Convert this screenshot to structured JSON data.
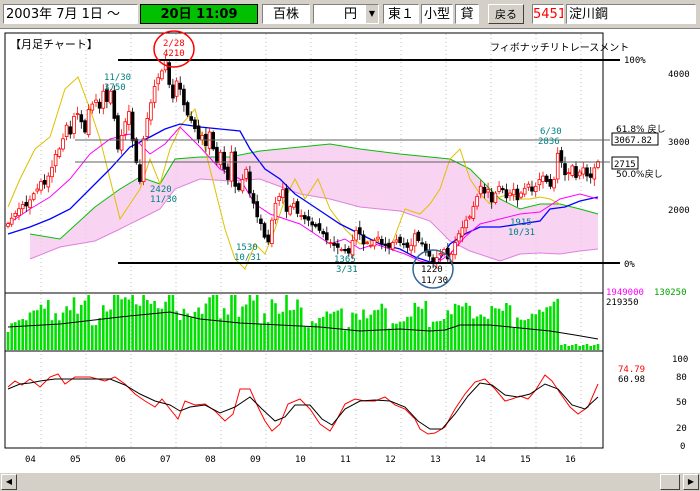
{
  "toolbar": {
    "start_date": "2003年 7月 1日 ～",
    "current_time": "20日 11:09",
    "unit": "百株",
    "currency": "円",
    "market": "東１",
    "size_class": "小型",
    "margin": "貸",
    "back_label": "戻る",
    "stock_code": "5451",
    "stock_name": "淀川鋼"
  },
  "colors": {
    "time_bg": "#00c000",
    "code_color": "#ff0000",
    "up_candle": "#ff0000",
    "down_candle": "#000000",
    "volume": "#00e000",
    "ma_blue": "#0000ff",
    "ma_pink": "#ff00ff",
    "lagging_yellow": "#e0c000",
    "cloud_green": "#00c000",
    "stoch_red": "#ff0000",
    "stoch_black": "#000000",
    "cyan_label": "#008080",
    "marker_red": "#ff0000",
    "marker_blue": "#336699"
  },
  "chart": {
    "title": "【月足チャート】",
    "fib_label": "フィボナッチリトレースメント",
    "fib_levels": [
      "100%",
      "61.8% 戻し",
      "50.0%戻し",
      "0%"
    ],
    "fib_value_618": "3067.82",
    "price_2715": "2715",
    "y_ticks": [
      "4000",
      "3000",
      "2000"
    ],
    "annotations": [
      {
        "date": "11/30",
        "price": "3750"
      },
      {
        "date": "11/30",
        "price": "2420"
      },
      {
        "date": "10/31",
        "price": "1530"
      },
      {
        "date": "3/31",
        "price": "1365"
      },
      {
        "date": "10/31",
        "price": "1915"
      },
      {
        "date": "6/30",
        "price": "2836"
      }
    ],
    "high_marker": {
      "date": "2/28",
      "price": "4210"
    },
    "low_marker": {
      "price": "1220",
      "date": "11/30"
    }
  },
  "volume": {
    "values_left": [
      "1949000",
      "219350"
    ],
    "value_right": "130250"
  },
  "stochastic": {
    "k_value": "74.79",
    "d_value": "60.98",
    "y_ticks": [
      "100",
      "80",
      "50",
      "20",
      "0"
    ]
  },
  "x_axis": [
    "04",
    "05",
    "06",
    "07",
    "08",
    "09",
    "10",
    "11",
    "12",
    "13",
    "14",
    "15",
    "16"
  ],
  "chart_data": {
    "type": "candlestick",
    "title": "【月足チャート】",
    "ylim": [
      1100,
      4400
    ],
    "x": [
      "03/07",
      "03/08",
      "03/09",
      "03/10",
      "03/11",
      "03/12",
      "04/01",
      "04/02",
      "04/03",
      "04/04",
      "04/05",
      "04/06",
      "04/07",
      "04/08",
      "04/09",
      "04/10",
      "04/11",
      "04/12",
      "05/01",
      "05/02",
      "05/03",
      "05/04",
      "05/05",
      "05/06",
      "05/07",
      "05/08",
      "05/09",
      "05/10",
      "05/11",
      "05/12",
      "06/01",
      "06/02",
      "06/03",
      "06/04",
      "06/05",
      "06/06",
      "06/07",
      "06/08",
      "06/09",
      "06/10",
      "06/11",
      "06/12",
      "07/01",
      "07/02",
      "07/03",
      "07/04",
      "07/05",
      "07/06",
      "07/07",
      "07/08",
      "07/09",
      "07/10",
      "07/11",
      "07/12",
      "08/01",
      "08/02",
      "08/03",
      "08/04",
      "08/05",
      "08/06",
      "08/07",
      "08/08",
      "08/09",
      "08/10",
      "08/11",
      "08/12",
      "09/01",
      "09/02",
      "09/03",
      "09/04",
      "09/05",
      "09/06",
      "09/07",
      "09/08",
      "09/09",
      "09/10",
      "09/11",
      "09/12",
      "10/01",
      "10/02",
      "10/03",
      "10/04",
      "10/05",
      "10/06",
      "10/07",
      "10/08",
      "10/09",
      "10/10",
      "10/11",
      "10/12",
      "11/01",
      "11/02",
      "11/03",
      "11/04",
      "11/05",
      "11/06",
      "11/07",
      "11/08",
      "11/09",
      "11/10",
      "11/11",
      "11/12",
      "12/01",
      "12/02",
      "12/03",
      "12/04",
      "12/05",
      "12/06",
      "12/07",
      "12/08",
      "12/09",
      "12/10",
      "12/11",
      "12/12",
      "13/01",
      "13/02",
      "13/03",
      "13/04",
      "13/05",
      "13/06",
      "13/07",
      "13/08",
      "13/09",
      "13/10",
      "13/11",
      "13/12",
      "14/01",
      "14/02",
      "14/03",
      "14/04",
      "14/05",
      "14/06",
      "14/07",
      "14/08",
      "14/09",
      "14/10",
      "14/11",
      "14/12",
      "15/01",
      "15/02",
      "15/03",
      "15/04",
      "15/05",
      "15/06",
      "15/07",
      "15/08",
      "15/09",
      "15/10",
      "15/11",
      "15/12",
      "16/01",
      "16/02",
      "16/03",
      "16/04",
      "16/05",
      "16/06",
      "16/07",
      "16/08"
    ],
    "close": [
      1800,
      1880,
      1950,
      2020,
      2080,
      2060,
      2150,
      2240,
      2310,
      2420,
      2380,
      2500,
      2630,
      2820,
      2900,
      3050,
      3250,
      3120,
      3380,
      3420,
      3300,
      3150,
      3480,
      3560,
      3620,
      3500,
      3750,
      3600,
      3750,
      3350,
      2900,
      3100,
      3300,
      3450,
      3020,
      2700,
      2420,
      3050,
      3350,
      3580,
      3820,
      3950,
      4050,
      4210,
      3850,
      3650,
      3900,
      3780,
      3550,
      3400,
      3320,
      3200,
      3050,
      3100,
      2950,
      3150,
      2900,
      2700,
      2850,
      2600,
      2450,
      2850,
      2350,
      2300,
      2450,
      2600,
      2250,
      2100,
      1900,
      1800,
      1600,
      1530,
      1850,
      2100,
      2200,
      2300,
      1980,
      2050,
      2100,
      1950,
      1920,
      1870,
      1850,
      1780,
      1760,
      1700,
      1650,
      1560,
      1520,
      1480,
      1450,
      1420,
      1400,
      1365,
      1550,
      1700,
      1650,
      1500,
      1520,
      1480,
      1550,
      1600,
      1500,
      1480,
      1450,
      1520,
      1560,
      1520,
      1500,
      1450,
      1480,
      1650,
      1550,
      1500,
      1380,
      1320,
      1220,
      1300,
      1360,
      1420,
      1280,
      1350,
      1520,
      1650,
      1740,
      1850,
      1900,
      2050,
      2200,
      2350,
      2250,
      2300,
      2120,
      2250,
      2350,
      2300,
      2180,
      2250,
      2300,
      2150,
      2250,
      2320,
      2380,
      2280,
      2350,
      2450,
      2500,
      2420,
      2350,
      2450,
      2836,
      2700,
      2520,
      2550,
      2650,
      2480,
      2560,
      2620,
      2500,
      2480,
      2620,
      2715
    ],
    "fib_levels": {
      "100%": 4210,
      "61.8%": 3067.82,
      "50.0%": 2715,
      "0%": 1220
    },
    "annotations": [
      {
        "date": "11/30",
        "price": 3750
      },
      {
        "date": "2/28",
        "price": 4210
      },
      {
        "date": "11/30",
        "price": 2420
      },
      {
        "date": "10/31",
        "price": 1530
      },
      {
        "date": "3/31",
        "price": 1365
      },
      {
        "date": "11/30",
        "price": 1220
      },
      {
        "date": "10/31",
        "price": 1915
      },
      {
        "date": "6/30",
        "price": 2836
      }
    ],
    "volume_latest": 130250,
    "stochastic": {
      "k": 74.79,
      "d": 60.98
    }
  }
}
